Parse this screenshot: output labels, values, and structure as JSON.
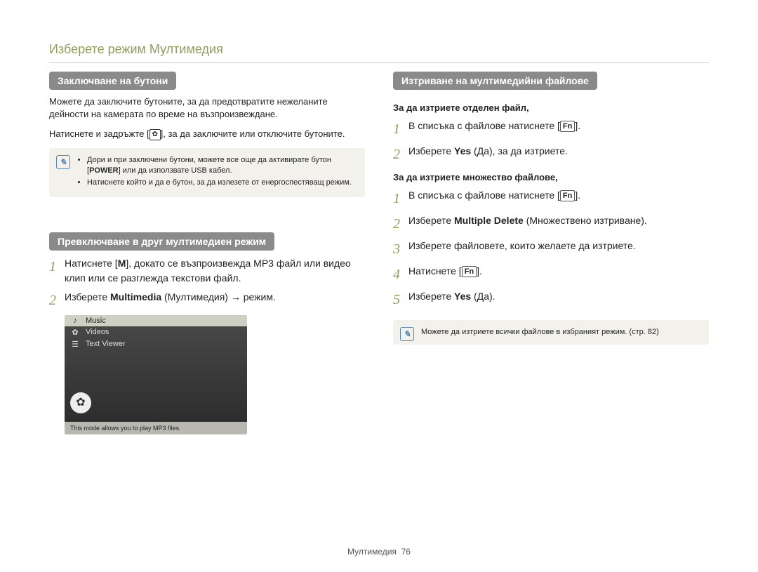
{
  "page_title": "Изберете режим Мултимедия",
  "left": {
    "section1_header": "Заключване на бутони",
    "section1_p1": "Можете да заключите бутоните, за да предотвратите нежеланите дейности на камерата по време на възпроизвеждане.",
    "section1_p2_a": "Натиснете и задръжте [",
    "section1_p2_b": "], за да заключите или отключите бутоните.",
    "lock_icon_glyph": "✿",
    "note1_bullet1_a": "Дори и при заключени бутони, можете все още да активирате бутон [",
    "note1_bullet1_power": "POWER",
    "note1_bullet1_b": "] или да използвате USB кабел.",
    "note1_bullet2": "Натиснете който и да е бутон, за да излезете от енергоспестяващ режим.",
    "section2_header": "Превключване в друг мултимедиен режим",
    "step1_num": "1",
    "step1_a": "Натиснете [",
    "step1_m": "M",
    "step1_b": "], докато се възпроизвежда MP3 файл или видео клип или се разглежда текстови файл.",
    "step2_num": "2",
    "step2_a": "Изберете ",
    "step2_bold": "Multimedia",
    "step2_b": " (Мултимедия) → режим.",
    "screenshot": {
      "items": [
        "Music",
        "Videos",
        "Text Viewer"
      ],
      "icons": [
        "♪",
        "✿",
        "☰"
      ],
      "big_icon": "✿",
      "footer": "This mode allows you to play MP3 files."
    }
  },
  "right": {
    "section_header": "Изтриване на мултимедийни файлове",
    "sub1": "За да изтриете отделен файл,",
    "s1_1_num": "1",
    "s1_1_a": "В списъка с файлове натиснете [",
    "s1_1_fn": "Fn",
    "s1_1_b": "].",
    "s1_2_num": "2",
    "s1_2_a": "Изберете ",
    "s1_2_yes": "Yes",
    "s1_2_b": " (Да), за да изтриете.",
    "sub2": "За да изтриете множество файлове,",
    "s2_1_num": "1",
    "s2_1_a": "В списъка с файлове натиснете [",
    "s2_1_fn": "Fn",
    "s2_1_b": "].",
    "s2_2_num": "2",
    "s2_2_a": "Изберете ",
    "s2_2_bold": "Multiple Delete",
    "s2_2_b": " (Множествено изтриване).",
    "s2_3_num": "3",
    "s2_3": "Изберете файловете, които желаете да изтриете.",
    "s2_4_num": "4",
    "s2_4_a": "Натиснете [",
    "s2_4_fn": "Fn",
    "s2_4_b": "].",
    "s2_5_num": "5",
    "s2_5_a": "Изберете ",
    "s2_5_yes": "Yes",
    "s2_5_b": " (Да).",
    "note2": "Можете да изтриете всички файлове в избраният режим. (стр. 82)"
  },
  "footer": {
    "label": "Мултимедия",
    "page": "76"
  }
}
